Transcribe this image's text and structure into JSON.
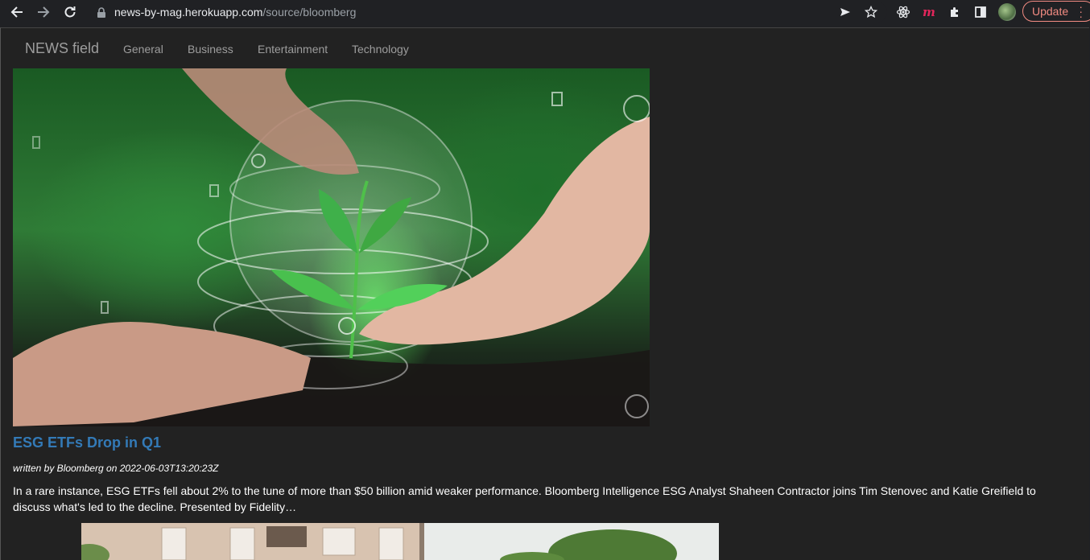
{
  "browser": {
    "url_host": "news-by-mag.herokuapp.com",
    "url_path": "/source/bloomberg",
    "update_label": "Update",
    "icons": [
      "back-arrow-icon",
      "forward-arrow-icon",
      "reload-icon",
      "lock-icon",
      "send-icon",
      "star-icon",
      "react-icon",
      "m-extension-icon",
      "puzzle-icon",
      "side-panel-icon",
      "profile-avatar",
      "more-menu-icon"
    ]
  },
  "navbar": {
    "brand": "NEWS field",
    "links": [
      {
        "label": "General"
      },
      {
        "label": "Business"
      },
      {
        "label": "Entertainment"
      },
      {
        "label": "Technology"
      }
    ]
  },
  "article": {
    "title": "ESG ETFs Drop in Q1",
    "byline": "written by Bloomberg on 2022-06-03T13:20:23Z",
    "description": "In a rare instance, ESG ETFs fell about 2% to the tune of more than $50 billion amid weaker performance. Bloomberg Intelligence ESG Analyst Shaheen Contractor joins Tim Stenovec and Katie Greifield to discuss what's led to the decline. Presented by Fidelity…"
  },
  "colors": {
    "link_blue": "#337ab7",
    "nav_gray": "#9d9d9d",
    "update_red": "#f28b82"
  }
}
